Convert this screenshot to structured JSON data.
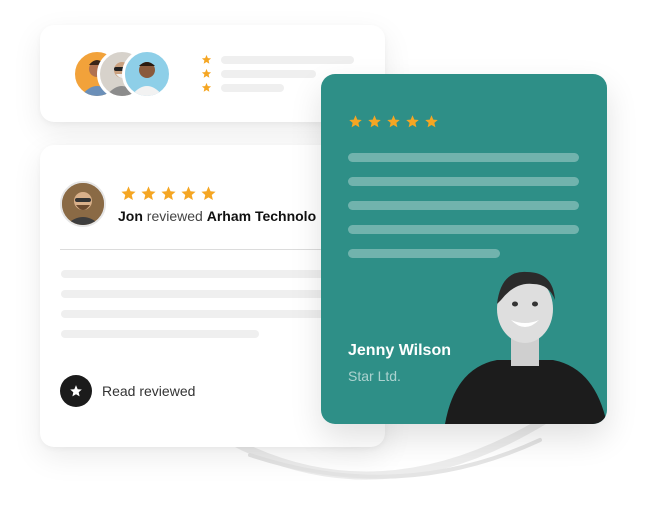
{
  "top_card": {
    "avatars": [
      {
        "icon": "avatar-woman-orange"
      },
      {
        "icon": "avatar-man-sunglasses"
      },
      {
        "icon": "avatar-man-smiling"
      }
    ],
    "rating_rows": 3
  },
  "review_card": {
    "rating": 5,
    "reviewer": "Jon",
    "action": "reviewed",
    "company": "Arham Technolo",
    "read_label": "Read reviewed"
  },
  "testimonial_card": {
    "rating": 5,
    "name": "Jenny Wilson",
    "company": "Star Ltd.",
    "background_color": "#2e8f87"
  },
  "colors": {
    "star": "#f5a623",
    "teal": "#2e8f87"
  }
}
